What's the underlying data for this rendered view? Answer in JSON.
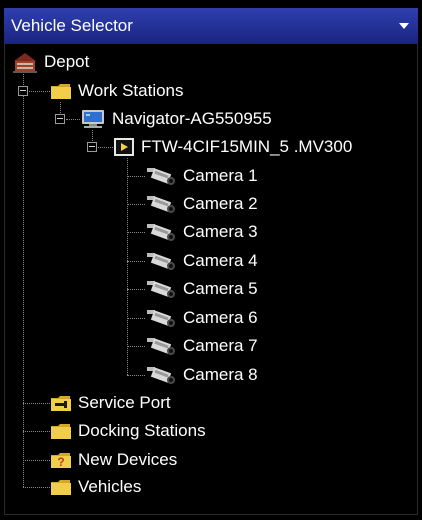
{
  "window": {
    "title": "Vehicle Selector",
    "dropdown_icon": "dropdown-arrow-icon"
  },
  "tree": {
    "root": {
      "label": "Depot",
      "icon": "depot-icon"
    },
    "work_stations": {
      "label": "Work Stations",
      "icon": "folder-icon"
    },
    "navigator": {
      "label": "Navigator-AG550955",
      "icon": "monitor-icon"
    },
    "recorder": {
      "label": "FTW-4CIF15MIN_5 .MV300",
      "icon": "recorder-icon"
    },
    "cameras": [
      {
        "label": "Camera 1",
        "icon": "camera-icon"
      },
      {
        "label": "Camera 2",
        "icon": "camera-icon"
      },
      {
        "label": "Camera 3",
        "icon": "camera-icon"
      },
      {
        "label": "Camera 4",
        "icon": "camera-icon"
      },
      {
        "label": "Camera 5",
        "icon": "camera-icon"
      },
      {
        "label": "Camera 6",
        "icon": "camera-icon"
      },
      {
        "label": "Camera 7",
        "icon": "camera-icon"
      },
      {
        "label": "Camera 8",
        "icon": "camera-icon"
      }
    ],
    "service_port": {
      "label": "Service Port",
      "icon": "service-port-icon"
    },
    "docking_stations": {
      "label": "Docking Stations",
      "icon": "folder-icon"
    },
    "new_devices": {
      "label": "New Devices",
      "icon": "new-devices-question-icon"
    },
    "vehicles": {
      "label": "Vehicles",
      "icon": "folder-icon"
    }
  },
  "colors": {
    "title_bar": "#2a37a0",
    "background": "#000000",
    "text": "#ffffff",
    "folder": "#f2cf4a"
  }
}
